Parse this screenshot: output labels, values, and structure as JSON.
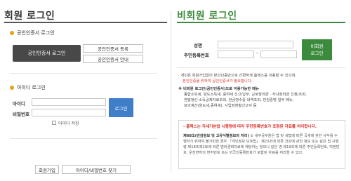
{
  "member_login": {
    "title": "회원 로그인",
    "cert_section": {
      "heading": "공인인증서 로그인",
      "login_button": "공인인증서 로그인",
      "register_button": "공인인증서 등록",
      "guide_button": "공인인증서 안내"
    },
    "id_section": {
      "heading": "아이디 로그인",
      "id_label": "아이디",
      "password_label": "비밀번호",
      "login_button": "로그인",
      "remember_label": "아이디 저장"
    },
    "signup_button": "회원가입",
    "find_button": "아이디/비밀번호 찾기"
  },
  "guest_login": {
    "title": "비회원 로그인",
    "name_label": "성명",
    "rrn_label": "주민등록번호",
    "rrn_separator": "-",
    "login_button_line1": "비회원",
    "login_button_line2": "로그인",
    "note1": "· 개인은 회원가입없이 본인인증만으로 간편하게 홈택스를 이용할 수 있으며,",
    "note1_red": "본인인증을 위하여 공인인증서가 필요합니다.",
    "note2_head": "※ 비회원 로그인(공인인증서)으로 이용가능한 메뉴",
    "note2_lines": [
      "종합소득세, 양도소득세, 증여세 신고/납부, 근로장려금 · 자녀장려금 신청/조회,",
      "연말정산 소득공제자료조회, 현금영수증 내역조회, 민원증명 일부 메뉴,",
      "모의계산(양도세,증여세), 사업장현황신고서 등"
    ],
    "notice_title": "- 홈택스는 국세기본법 시행령에 따라 주민등록번호가 포함된 자료를 처리합니다.",
    "notice_bold": "제68조(민감정보 및 고유식별정보의 처리)",
    "notice_body": " ② 세무공무원은 법 및 세법에 따른 국세에 관한 사무를 수행하기 위하여 불가피한 경우 「개인정보 보호법」 제23조에 따른 건강에 관한 정보 또는 같은 법 시행령 제18조제2호에 따른 범죄경력자료에 해당하는 정보나 같은 영 제19조에 따른 주민등록번호, 여권번호, 운전면허의 면허번호 또는 외국인등록번호가 포함된 자료를 처리할 수 있다."
  },
  "colors": {
    "dark_button": "#484848",
    "blue_button": "#3f7ec9",
    "green_accent": "#3c8a3c",
    "red_text": "#d9302a",
    "bullet": "#e8a317"
  }
}
